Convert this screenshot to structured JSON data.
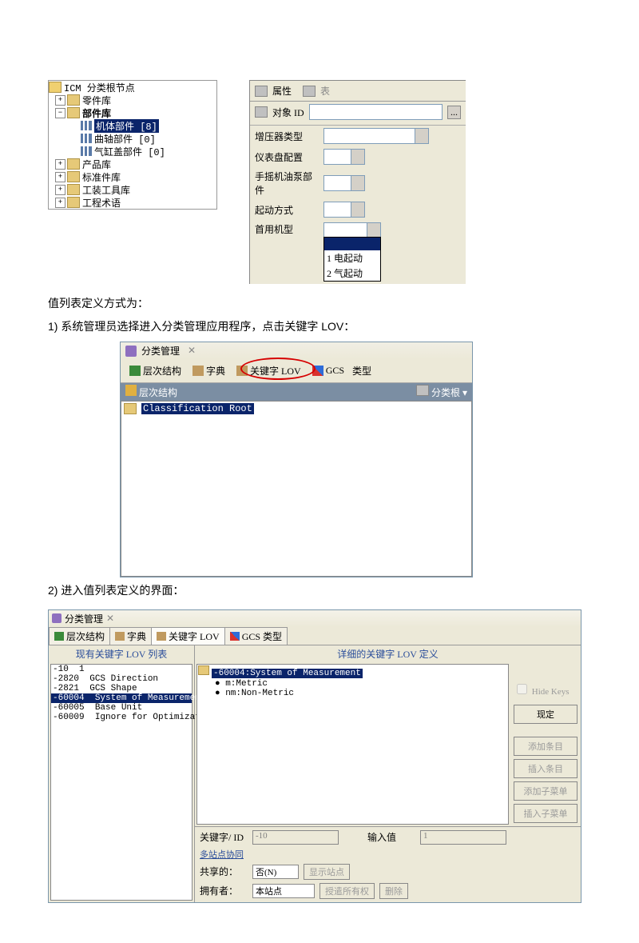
{
  "fig1": {
    "tree": {
      "root": "ICM 分类根节点",
      "items": [
        "零件库",
        "部件库",
        "产品库",
        "标准件库",
        "工装工具库",
        "工程术语"
      ],
      "sub": [
        {
          "label": "机体部件  [8]",
          "selected": true
        },
        {
          "label": "曲轴部件  [0]"
        },
        {
          "label": "气缸盖部件  [0]"
        }
      ]
    },
    "props": {
      "tabs": {
        "attr": "属性",
        "table": "表"
      },
      "objid": "对象 ID",
      "rows": [
        "增压器类型",
        "仪表盘配置",
        "手摇机油泵部件",
        "起动方式",
        "首用机型"
      ],
      "dropdown": {
        "opt1": "1  电起动",
        "opt2": "2  气起动"
      }
    }
  },
  "text": {
    "p1": "值列表定义方式为：",
    "n1": "1)  系统管理员选择进入分类管理应用程序，点击关键字 LOV：",
    "n2": "2)  进入值列表定义的界面："
  },
  "fig2": {
    "title": "分类管理",
    "tabs": {
      "t1": "层次结构",
      "t2": "字典",
      "t3": "关键字  LOV",
      "t4": "GCS",
      "t5": "类型"
    },
    "subhdr": {
      "left": "层次结构",
      "right": "分类根"
    },
    "root": "Classification Root"
  },
  "fig3": {
    "title": "分类管理",
    "tabs": {
      "t1": "层次结构",
      "t2": "字典",
      "t3": "关键字  LOV",
      "t4": "GCS 类型"
    },
    "left": {
      "title": "现有关键字 LOV 列表",
      "rows": [
        {
          "k": "-10",
          "v": "1"
        },
        {
          "k": "-2820",
          "v": "GCS Direction"
        },
        {
          "k": "-2821",
          "v": "GCS Shape"
        },
        {
          "k": "-60004",
          "v": "System of Measurement",
          "sel": true
        },
        {
          "k": "-60005",
          "v": "Base Unit"
        },
        {
          "k": "-60009",
          "v": "Ignore for Optimization"
        }
      ]
    },
    "right": {
      "title": "详细的关键字 LOV 定义",
      "hide": "Hide Keys",
      "tree": {
        "root": "-60004:System of Measurement",
        "c1": "m:Metric",
        "c2": "nm:Non-Metric"
      },
      "buttons": {
        "b1": "现定",
        "b2": "添加条目",
        "b3": "插入条目",
        "b4": "添加子菜单",
        "b5": "插入子菜单"
      },
      "form": {
        "kwid": "关键字/ ID",
        "kwid_v": "-10",
        "inval": "输入值",
        "inval_v": "1",
        "multi": "多站点协同",
        "shared": "共享的：",
        "shared_v": "否(N)",
        "showsite": "显示站点",
        "owner": "拥有者：",
        "owner_v": "本站点",
        "grant": "授遣所有权",
        "del": "删除"
      }
    }
  }
}
